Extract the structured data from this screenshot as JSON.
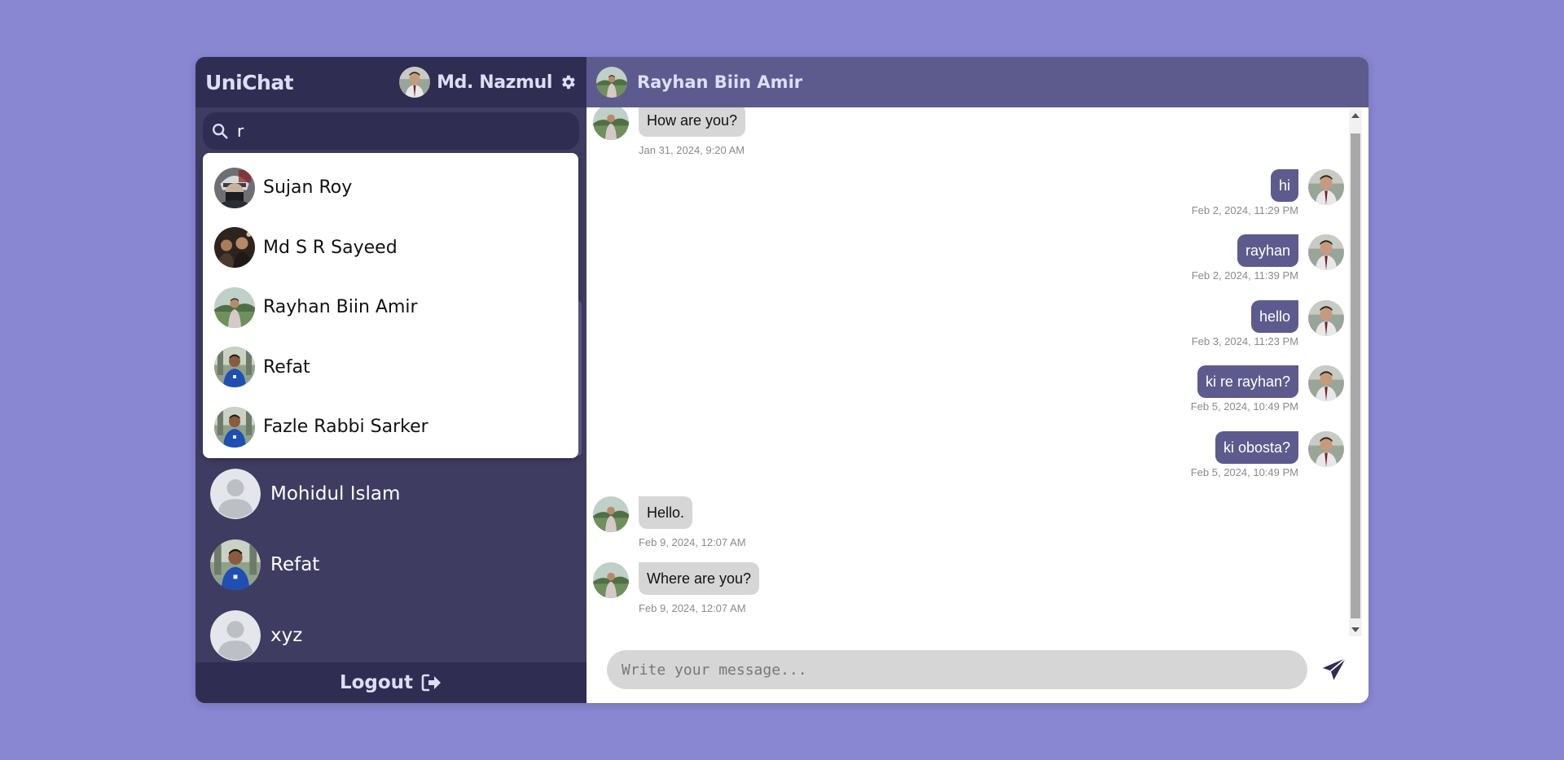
{
  "app": {
    "title": "UniChat"
  },
  "user": {
    "name": "Md. Nazmul"
  },
  "search": {
    "value": "r",
    "placeholder": ""
  },
  "search_results": [
    {
      "name": "Sujan Roy",
      "avatar": "masked-ninja"
    },
    {
      "name": "Md S R Sayeed",
      "avatar": "group-photo"
    },
    {
      "name": "Rayhan Biin Amir",
      "avatar": "outdoor-person"
    },
    {
      "name": "Refat",
      "avatar": "blue-jersey"
    },
    {
      "name": "Fazle Rabbi Sarker",
      "avatar": "blue-jersey"
    }
  ],
  "chats": [
    {
      "name": "Mohidul Islam",
      "avatar": "default-user"
    },
    {
      "name": "Refat",
      "avatar": "blue-jersey"
    },
    {
      "name": "xyz",
      "avatar": "default-user"
    }
  ],
  "logout": {
    "label": "Logout"
  },
  "conversation": {
    "contact_name": "Rayhan Biin Amir",
    "messages": [
      {
        "direction": "in",
        "text": "How are you?",
        "time": "Jan 31, 2024, 9:20 AM"
      },
      {
        "direction": "out",
        "text": "hi",
        "time": "Feb 2, 2024, 11:29 PM"
      },
      {
        "direction": "out",
        "text": "rayhan",
        "time": "Feb 2, 2024, 11:39 PM"
      },
      {
        "direction": "out",
        "text": "hello",
        "time": "Feb 3, 2024, 11:23 PM"
      },
      {
        "direction": "out",
        "text": "ki re rayhan?",
        "time": "Feb 5, 2024, 10:49 PM"
      },
      {
        "direction": "out",
        "text": "ki obosta?",
        "time": "Feb 5, 2024, 10:49 PM"
      },
      {
        "direction": "in",
        "text": "Hello.",
        "time": "Feb 9, 2024, 12:07 AM"
      },
      {
        "direction": "in",
        "text": "Where are you?",
        "time": "Feb 9, 2024, 12:07 AM"
      }
    ]
  },
  "composer": {
    "placeholder": "Write your message..."
  },
  "colors": {
    "background": "#8986d2",
    "sidebar": "#3e3c61",
    "sidebar_header": "#2f2d52",
    "chat_header": "#5d5b8d",
    "outgoing_bubble": "#5d5b8d",
    "incoming_bubble": "#d6d6d6"
  }
}
